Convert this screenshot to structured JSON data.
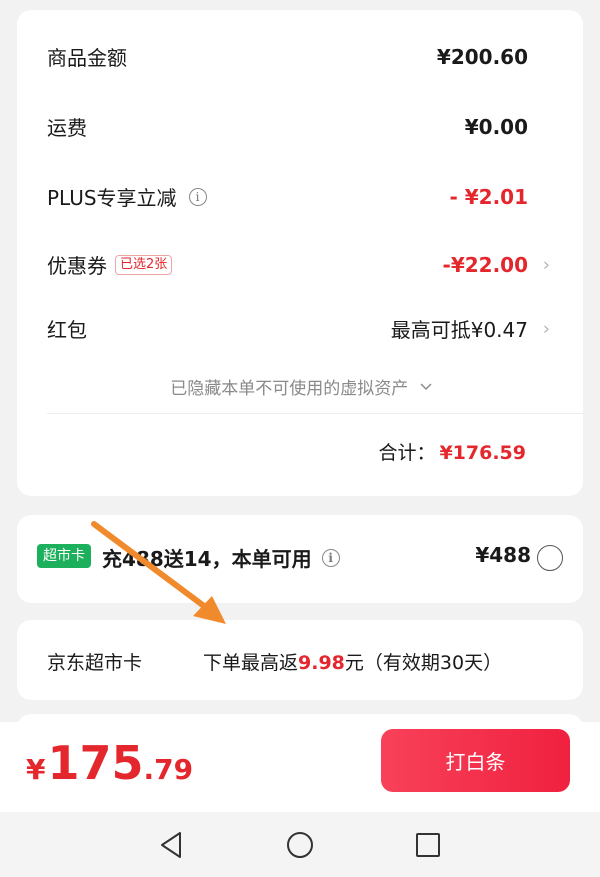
{
  "summary": {
    "rows": [
      {
        "label": "商品金额",
        "value": "¥200.60"
      },
      {
        "label": "运费",
        "value": "¥0.00"
      },
      {
        "label": "PLUS专享立减",
        "value": "- ¥2.01"
      },
      {
        "label": "优惠券",
        "badge": "已选2张",
        "value": "-¥22.00"
      },
      {
        "label": "红包",
        "value": "最高可抵¥0.47"
      }
    ],
    "hidden_note": "已隐藏本单不可使用的虚拟资产",
    "total_label": "合计：",
    "total_value": "¥176.59"
  },
  "supermarket": {
    "badge": "超市卡",
    "promo": "充488送14，本单可用",
    "price": "¥488"
  },
  "rebate": {
    "label": "京东超市卡",
    "text_prefix": "下单最高返",
    "amount": "9.98",
    "text_suffix": "元（有效期30天）"
  },
  "footer": {
    "currency": "¥",
    "price_int": "175",
    "price_dec": ".79",
    "pay_label": "打白条"
  },
  "colors": {
    "accent_red": "#e4262d",
    "green_badge": "#1cb05c",
    "arrow_orange": "#f08a2c"
  },
  "icons": [
    "info-icon",
    "chevron-right-icon",
    "chevron-down-icon",
    "radio-icon",
    "back-icon",
    "home-icon",
    "recents-icon"
  ]
}
